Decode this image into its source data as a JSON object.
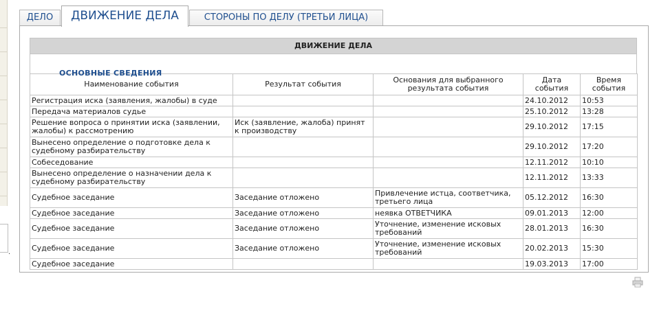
{
  "tabs": [
    {
      "label": "ДЕЛО",
      "active": false
    },
    {
      "label": "ДВИЖЕНИЕ ДЕЛА",
      "active": true
    },
    {
      "label": "СТОРОНЫ ПО ДЕЛУ (ТРЕТЬИ ЛИЦА)",
      "active": false
    }
  ],
  "panel": {
    "heading": "ДВИЖЕНИЕ ДЕЛА",
    "section_title": "ОСНОВНЫЕ СВЕДЕНИЯ"
  },
  "table": {
    "columns": [
      "Наименование события",
      "Результат события",
      "Основания для выбранного результата события",
      "Дата события",
      "Время события"
    ],
    "rows": [
      {
        "event": "Регистрация иска (заявления, жалобы) в суде",
        "result": "",
        "basis": "",
        "date": "24.10.2012",
        "time": "10:53"
      },
      {
        "event": "Передача материалов судье",
        "result": "",
        "basis": "",
        "date": "25.10.2012",
        "time": "13:28"
      },
      {
        "event": "Решение вопроса о принятии иска (заявлении, жалобы) к рассмотрению",
        "result": "Иск (заявление, жалоба) принят к производству",
        "basis": "",
        "date": "29.10.2012",
        "time": "17:15"
      },
      {
        "event": "Вынесено определение о подготовке дела к судебному разбирательству",
        "result": "",
        "basis": "",
        "date": "29.10.2012",
        "time": "17:20"
      },
      {
        "event": "Собеседование",
        "result": "",
        "basis": "",
        "date": "12.11.2012",
        "time": "10:10"
      },
      {
        "event": "Вынесено определение о назначении дела к судебному разбирательству",
        "result": "",
        "basis": "",
        "date": "12.11.2012",
        "time": "13:33"
      },
      {
        "event": "Судебное заседание",
        "result": "Заседание отложено",
        "basis": "Привлечение истца, соответчика, третьего лица",
        "date": "05.12.2012",
        "time": "16:30"
      },
      {
        "event": "Судебное заседание",
        "result": "Заседание отложено",
        "basis": "неявка ОТВЕТЧИКА",
        "date": "09.01.2013",
        "time": "12:00"
      },
      {
        "event": "Судебное заседание",
        "result": "Заседание отложено",
        "basis": "Уточнение, изменение исковых требований",
        "date": "28.01.2013",
        "time": "16:30"
      },
      {
        "event": "Судебное заседание",
        "result": "Заседание отложено",
        "basis": "Уточнение, изменение исковых требований",
        "date": "20.02.2013",
        "time": "15:30"
      },
      {
        "event": "Судебное заседание",
        "result": "",
        "basis": "",
        "date": "19.03.2013",
        "time": "17:00"
      }
    ]
  },
  "left_mark": ".",
  "icons": {
    "print": "printer-icon"
  },
  "colors": {
    "tab_text": "#1f4f8f",
    "heading_bg": "#d4d4d4",
    "border": "#c4c4c4"
  }
}
